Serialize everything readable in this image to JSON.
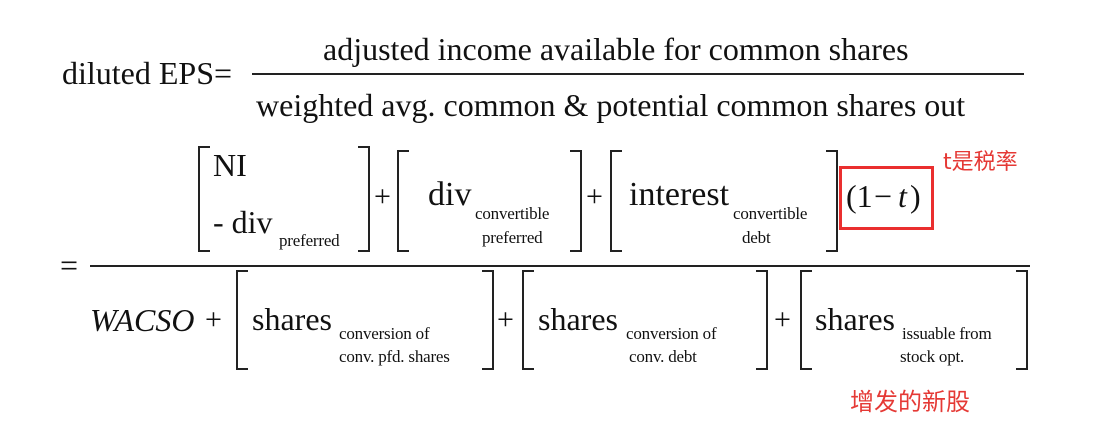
{
  "top": {
    "lhs": "diluted EPS=",
    "numerator": "adjusted income available for common shares",
    "denominator": "weighted avg. common & potential common shares out"
  },
  "bottom": {
    "equals": "=",
    "num": {
      "ni": "NI",
      "div_pref_main": "- div",
      "div_pref_sub": "preferred",
      "plus1": "+",
      "div_conv_main": "div",
      "div_conv_sub1": "convertible",
      "div_conv_sub2": "preferred",
      "plus2": "+",
      "int_main": "interest",
      "int_sub1": "convertible",
      "int_sub2": "debt",
      "tax_open": "(1",
      "tax_minus": "−",
      "tax_t": "t",
      "tax_close": ")"
    },
    "den": {
      "wacso": "WACSO",
      "plus0": "+",
      "sh1_main": "shares",
      "sh1_sub1": "conversion of",
      "sh1_sub2": "conv. pfd. shares",
      "plus1": "+",
      "sh2_main": "shares",
      "sh2_sub1": "conversion of",
      "sh2_sub2": "conv.  debt",
      "plus2": "+",
      "sh3_main": "shares",
      "sh3_sub1": "issuable from",
      "sh3_sub2": "stock opt."
    }
  },
  "annotations": {
    "tax_note": "t是税率",
    "shares_note": "增发的新股",
    "color": "#e53935"
  }
}
